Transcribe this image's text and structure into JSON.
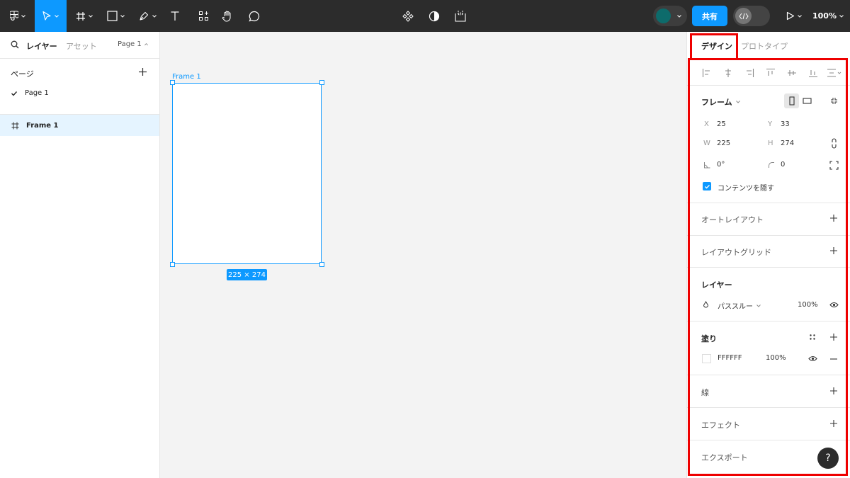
{
  "toolbar": {
    "share_label": "共有",
    "zoom_label": "100%",
    "avatar_color": "#0d6b6b",
    "accent_color": "#0d99ff"
  },
  "left_panel": {
    "tab_layers": "レイヤー",
    "tab_assets": "アセット",
    "page_selector": "Page 1",
    "pages_title": "ページ",
    "pages": [
      {
        "label": "Page 1",
        "selected": true
      }
    ],
    "layers": [
      {
        "label": "Frame 1",
        "selected": true
      }
    ]
  },
  "canvas": {
    "frame_label": "Frame 1",
    "dimension_badge": "225 × 274"
  },
  "right_panel": {
    "tab_design": "デザイン",
    "tab_prototype": "プロトタイプ",
    "frame_section": {
      "title": "フレーム",
      "x_label": "X",
      "x_value": "25",
      "y_label": "Y",
      "y_value": "33",
      "w_label": "W",
      "w_value": "225",
      "h_label": "H",
      "h_value": "274",
      "rotation_value": "0°",
      "radius_value": "0",
      "clip_content_label": "コンテンツを隠す",
      "clip_content_checked": true
    },
    "auto_layout_title": "オートレイアウト",
    "layout_grid_title": "レイアウトグリッド",
    "layer_section": {
      "title": "レイヤー",
      "blend_mode": "パススルー",
      "opacity": "100%"
    },
    "fill_section": {
      "title": "塗り",
      "hex": "FFFFFF",
      "opacity": "100%"
    },
    "stroke_title": "線",
    "effects_title": "エフェクト",
    "export_title": "エクスポート"
  },
  "help_label": "?"
}
